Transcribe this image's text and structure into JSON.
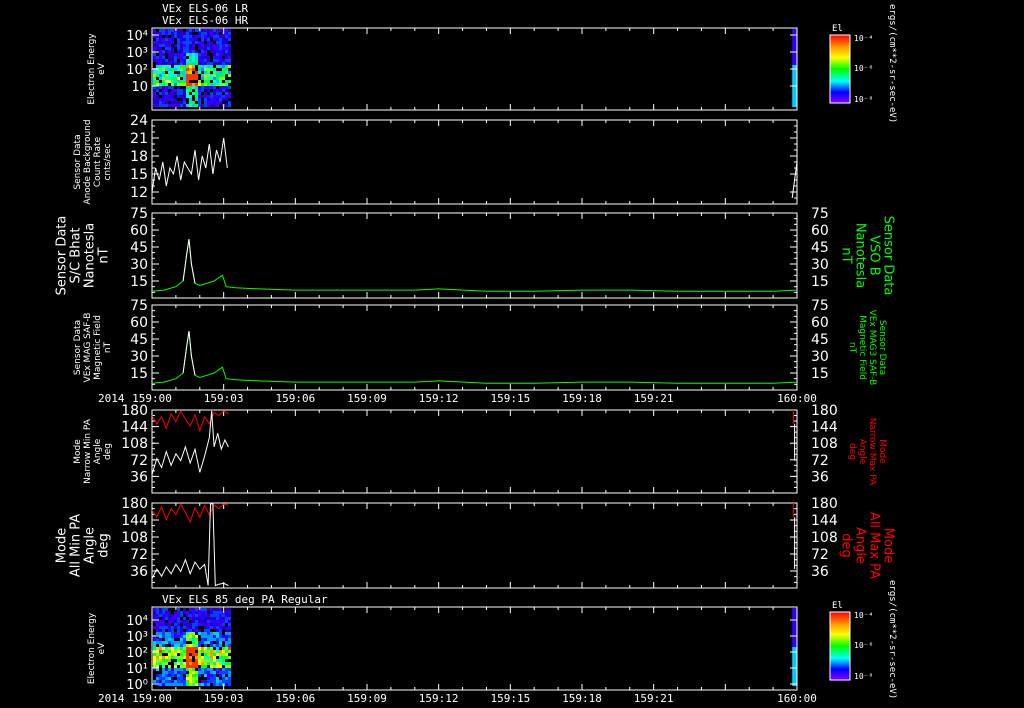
{
  "titles": {
    "top_line1": "VEx ELS-06 LR",
    "top_line2": "VEx ELS-06 HR",
    "bottom": "VEx ELS 85 deg PA Regular"
  },
  "time_axis": {
    "year": "2014",
    "ticks": [
      "159:00",
      "159:03",
      "159:06",
      "159:09",
      "159:12",
      "159:15",
      "159:18",
      "159:21",
      "160:00"
    ]
  },
  "colorbar": {
    "title": "El",
    "units": "ergs/(cm**2-sr-sec-eV)",
    "tick_labels": [
      "10⁻⁴",
      "10⁻⁶",
      "10⁻⁸"
    ]
  },
  "colors": {
    "background": "#000000",
    "axis": "#ffffff",
    "green_trace": "#00ff00",
    "red_trace": "#ff0000",
    "white_trace": "#ffffff"
  },
  "chart_data": [
    {
      "type": "heatmap",
      "panel": "electron-energy-upper",
      "ylabel_lines": [
        "Electron Energy",
        "eV"
      ],
      "yscale": "log",
      "ytick_labels": [
        "10",
        "10²",
        "10³",
        "10⁴"
      ],
      "data_coverage": "159:00 to about 159:03 and just before 160:00",
      "colorbar": true
    },
    {
      "type": "line",
      "panel": "sensor-background",
      "ylabel_lines": [
        "Sensor Data",
        "Anode Background",
        "Count Rate",
        "cnts/sec"
      ],
      "ylim": [
        10,
        24
      ],
      "yticks": [
        12,
        15,
        18,
        21,
        24
      ],
      "series": [
        {
          "color": "#ffffff",
          "x": [
            0.0,
            0.15,
            0.3,
            0.45,
            0.6,
            0.75,
            0.9,
            1.05,
            1.2,
            1.35,
            1.5,
            1.65,
            1.8,
            1.95,
            2.1,
            2.25,
            2.4,
            2.55,
            2.7,
            2.85,
            3.0,
            3.15
          ],
          "y": [
            12,
            16,
            14,
            17,
            13,
            16,
            15,
            18,
            14,
            17,
            16,
            15,
            19,
            14,
            18,
            16,
            20,
            15,
            19,
            17,
            21,
            16
          ]
        },
        {
          "color": "#ffffff",
          "x": [
            26.8,
            26.9,
            27.0
          ],
          "y": [
            11,
            14,
            17
          ]
        }
      ]
    },
    {
      "type": "line",
      "panel": "sc-bhat",
      "ylabel_lines": [
        "Sensor Data",
        "S/C Bhat",
        "Nanotesla",
        "nT"
      ],
      "right_label_lines": [
        "Sensor Data",
        "VSO B",
        "Nanotesla",
        "nT"
      ],
      "ylim": [
        0,
        75
      ],
      "yticks": [
        15,
        30,
        45,
        60,
        75
      ],
      "series": [
        {
          "color": "#00ff00",
          "x": [
            0.0,
            0.5,
            1.0,
            1.3,
            1.45,
            1.55,
            1.65,
            1.8,
            2.0,
            2.3,
            2.6,
            2.8,
            2.95,
            3.1,
            3.5,
            4.5,
            6.0,
            8.0,
            10.0,
            11.0,
            12.0,
            14.0,
            16.0,
            18.0,
            20.0,
            22.0,
            24.0,
            26.0,
            27.0
          ],
          "y": [
            6,
            7,
            10,
            15,
            38,
            52,
            30,
            13,
            11,
            13,
            15,
            18,
            20,
            10,
            9,
            8,
            7,
            7,
            7,
            7,
            8,
            6,
            6,
            7,
            7,
            6,
            6,
            6,
            7
          ]
        },
        {
          "color": "#ffffff",
          "x": [
            1.3,
            1.45,
            1.55,
            1.65,
            1.8
          ],
          "y": [
            15,
            38,
            52,
            30,
            13
          ]
        }
      ]
    },
    {
      "type": "line",
      "panel": "mag-saf-b",
      "ylabel_lines": [
        "Sensor Data",
        "VEx MAG SAF-B",
        "Magnetic Field",
        "nT"
      ],
      "right_label_lines": [
        "Sensor Data",
        "VEx MAG3 SAF-B",
        "Magnetic Field",
        "nT"
      ],
      "ylim": [
        0,
        75
      ],
      "yticks": [
        15,
        30,
        45,
        60,
        75
      ],
      "series": [
        {
          "color": "#00ff00",
          "x": [
            0.0,
            0.5,
            1.0,
            1.3,
            1.45,
            1.55,
            1.65,
            1.8,
            2.0,
            2.3,
            2.6,
            2.8,
            2.95,
            3.1,
            3.5,
            4.5,
            6.0,
            8.0,
            10.0,
            11.0,
            12.0,
            14.0,
            16.0,
            18.0,
            20.0,
            22.0,
            24.0,
            26.0,
            27.0
          ],
          "y": [
            6,
            7,
            10,
            15,
            38,
            52,
            30,
            13,
            11,
            13,
            15,
            18,
            20,
            10,
            9,
            8,
            7,
            7,
            7,
            7,
            8,
            6,
            6,
            7,
            7,
            6,
            6,
            6,
            7
          ]
        },
        {
          "color": "#ffffff",
          "x": [
            1.3,
            1.45,
            1.55,
            1.65,
            1.8
          ],
          "y": [
            15,
            38,
            52,
            30,
            13
          ]
        }
      ]
    },
    {
      "type": "line",
      "panel": "narrow-pa",
      "ylabel_lines": [
        "Mode",
        "Narrow Min PA",
        "Angle",
        "deg"
      ],
      "right_label_lines": [
        "Mode",
        "Narrow Max PA",
        "Angle",
        "deg"
      ],
      "ylim": [
        0,
        180
      ],
      "yticks": [
        36,
        72,
        108,
        144,
        180
      ],
      "series": [
        {
          "color": "#ff0000",
          "x": [
            0.0,
            0.2,
            0.4,
            0.6,
            0.8,
            1.0,
            1.2,
            1.4,
            1.6,
            1.8,
            2.0,
            2.2,
            2.4,
            2.6,
            2.8,
            3.0,
            3.2
          ],
          "y": [
            168,
            150,
            165,
            140,
            172,
            155,
            178,
            160,
            145,
            170,
            135,
            165,
            150,
            175,
            168,
            178,
            172
          ]
        },
        {
          "color": "#ffffff",
          "x": [
            0.0,
            0.2,
            0.4,
            0.6,
            0.8,
            1.0,
            1.2,
            1.4,
            1.6,
            1.8,
            2.0,
            2.2,
            2.4,
            2.5,
            2.6,
            2.75,
            2.9,
            3.05,
            3.2
          ],
          "y": [
            40,
            75,
            55,
            90,
            60,
            85,
            70,
            100,
            65,
            95,
            45,
            80,
            120,
            178,
            100,
            130,
            95,
            115,
            100
          ]
        },
        {
          "color": "#ff0000",
          "x": [
            26.85,
            26.85
          ],
          "y": [
            150,
            180
          ]
        },
        {
          "color": "#ffffff",
          "x": [
            26.9,
            26.9
          ],
          "y": [
            70,
            150
          ]
        }
      ]
    },
    {
      "type": "line",
      "panel": "all-pa",
      "ylabel_lines": [
        "Mode",
        "All Min PA",
        "Angle",
        "deg"
      ],
      "right_label_lines": [
        "Mode",
        "All Max PA",
        "Angle",
        "deg"
      ],
      "ylim": [
        0,
        180
      ],
      "yticks": [
        36,
        72,
        108,
        144,
        180
      ],
      "series": [
        {
          "color": "#ff0000",
          "x": [
            0.0,
            0.2,
            0.4,
            0.6,
            0.8,
            1.0,
            1.2,
            1.4,
            1.6,
            1.8,
            2.0,
            2.2,
            2.4,
            2.6,
            2.8,
            3.0,
            3.2
          ],
          "y": [
            165,
            150,
            172,
            145,
            168,
            155,
            178,
            160,
            140,
            170,
            150,
            175,
            155,
            176,
            168,
            178,
            175
          ]
        },
        {
          "color": "#ffffff",
          "x": [
            0.0,
            0.2,
            0.4,
            0.6,
            0.8,
            1.0,
            1.2,
            1.4,
            1.6,
            1.8,
            2.0,
            2.2,
            2.35,
            2.45,
            2.55,
            2.65,
            2.8,
            3.0,
            3.2
          ],
          "y": [
            20,
            40,
            25,
            45,
            30,
            50,
            35,
            60,
            30,
            55,
            40,
            50,
            5,
            178,
            178,
            5,
            8,
            10,
            5
          ]
        },
        {
          "color": "#ff0000",
          "x": [
            26.85,
            26.85
          ],
          "y": [
            150,
            180
          ]
        },
        {
          "color": "#ffffff",
          "x": [
            26.9,
            26.9
          ],
          "y": [
            40,
            150
          ]
        }
      ]
    },
    {
      "type": "heatmap",
      "panel": "electron-energy-lower",
      "ylabel_lines": [
        "Electron Energy",
        "eV"
      ],
      "yscale": "log",
      "ytick_labels": [
        "10⁰",
        "10¹",
        "10²",
        "10³",
        "10⁴"
      ],
      "data_coverage": "159:00 to about 159:03 and just before 160:00",
      "colorbar": true
    }
  ]
}
